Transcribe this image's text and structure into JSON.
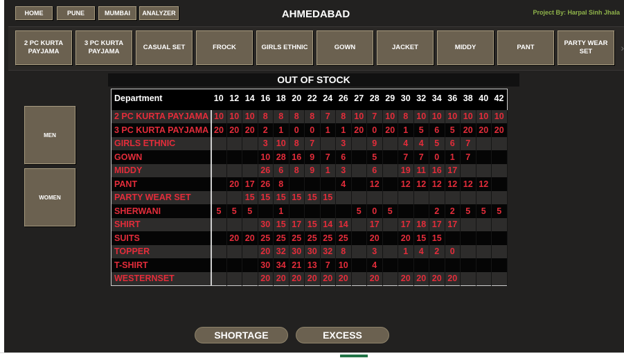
{
  "topnav": [
    "HOME",
    "PUNE",
    "MUMBAI",
    "ANALYZER"
  ],
  "title": "AHMEDABAD",
  "credit": "Project By: Harpal Sinh Jhala",
  "categories": [
    "2 PC KURTA PAYJAMA",
    "3 PC KURTA PAYJAMA",
    "CASUAL SET",
    "FROCK",
    "GIRLS ETHNIC",
    "GOWN",
    "JACKET",
    "MIDDY",
    "PANT",
    "PARTY WEAR SET"
  ],
  "side": {
    "men": "MEN",
    "women": "WOMEN"
  },
  "table": {
    "heading": "OUT OF STOCK",
    "dept_header": "Department",
    "sizes": [
      "10",
      "12",
      "14",
      "16",
      "18",
      "20",
      "22",
      "24",
      "26",
      "27",
      "28",
      "29",
      "30",
      "32",
      "34",
      "36",
      "38",
      "40",
      "42"
    ],
    "rows": [
      {
        "dept": "2 PC KURTA PAYJAMA",
        "values": [
          "10",
          "10",
          "10",
          "8",
          "8",
          "8",
          "8",
          "7",
          "8",
          "10",
          "7",
          "10",
          "8",
          "10",
          "10",
          "10",
          "10",
          "10",
          "10"
        ]
      },
      {
        "dept": "3 PC KURTA PAYJAMA",
        "values": [
          "20",
          "20",
          "20",
          "2",
          "1",
          "0",
          "0",
          "1",
          "1",
          "20",
          "0",
          "20",
          "1",
          "5",
          "6",
          "5",
          "20",
          "20",
          "20"
        ]
      },
      {
        "dept": "GIRLS ETHNIC",
        "values": [
          "",
          "",
          "",
          "3",
          "10",
          "8",
          "7",
          "",
          "3",
          "",
          "9",
          "",
          "4",
          "4",
          "5",
          "6",
          "7",
          "",
          ""
        ]
      },
      {
        "dept": "GOWN",
        "values": [
          "",
          "",
          "",
          "10",
          "28",
          "16",
          "9",
          "7",
          "6",
          "",
          "5",
          "",
          "7",
          "7",
          "0",
          "1",
          "7",
          "",
          ""
        ]
      },
      {
        "dept": "MIDDY",
        "values": [
          "",
          "",
          "",
          "26",
          "6",
          "8",
          "9",
          "1",
          "3",
          "",
          "6",
          "",
          "19",
          "11",
          "16",
          "17",
          "",
          "",
          ""
        ]
      },
      {
        "dept": "PANT",
        "values": [
          "",
          "20",
          "17",
          "26",
          "8",
          "",
          "",
          "",
          "4",
          "",
          "12",
          "",
          "12",
          "12",
          "12",
          "12",
          "12",
          "12",
          ""
        ]
      },
      {
        "dept": "PARTY WEAR SET",
        "values": [
          "",
          "",
          "15",
          "15",
          "15",
          "15",
          "15",
          "15",
          "",
          "",
          "",
          "",
          "",
          "",
          "",
          "",
          "",
          "",
          ""
        ]
      },
      {
        "dept": "SHERWANI",
        "values": [
          "5",
          "5",
          "5",
          "",
          "1",
          "",
          "",
          "",
          "",
          "5",
          "0",
          "5",
          "",
          "",
          "2",
          "2",
          "5",
          "5",
          "5"
        ]
      },
      {
        "dept": "SHIRT",
        "values": [
          "",
          "",
          "",
          "30",
          "15",
          "17",
          "15",
          "14",
          "14",
          "",
          "17",
          "",
          "17",
          "18",
          "17",
          "17",
          "",
          "",
          ""
        ]
      },
      {
        "dept": "SUITS",
        "values": [
          "",
          "20",
          "20",
          "25",
          "25",
          "25",
          "25",
          "25",
          "25",
          "",
          "20",
          "",
          "20",
          "15",
          "15",
          "",
          "",
          "",
          ""
        ]
      },
      {
        "dept": "TOPPER",
        "values": [
          "",
          "",
          "",
          "20",
          "32",
          "30",
          "30",
          "32",
          "8",
          "",
          "3",
          "",
          "1",
          "4",
          "2",
          "0",
          "",
          "",
          ""
        ]
      },
      {
        "dept": "T-SHIRT",
        "values": [
          "",
          "",
          "",
          "30",
          "34",
          "21",
          "13",
          "7",
          "10",
          "",
          "4",
          "",
          "",
          "",
          "",
          "",
          "",
          "",
          ""
        ]
      },
      {
        "dept": "WESTERNSET",
        "values": [
          "",
          "",
          "",
          "20",
          "20",
          "20",
          "20",
          "20",
          "20",
          "",
          "20",
          "",
          "20",
          "20",
          "20",
          "20",
          "",
          "",
          ""
        ]
      }
    ]
  },
  "bottom": {
    "shortage": "SHORTAGE",
    "excess": "EXCESS"
  }
}
